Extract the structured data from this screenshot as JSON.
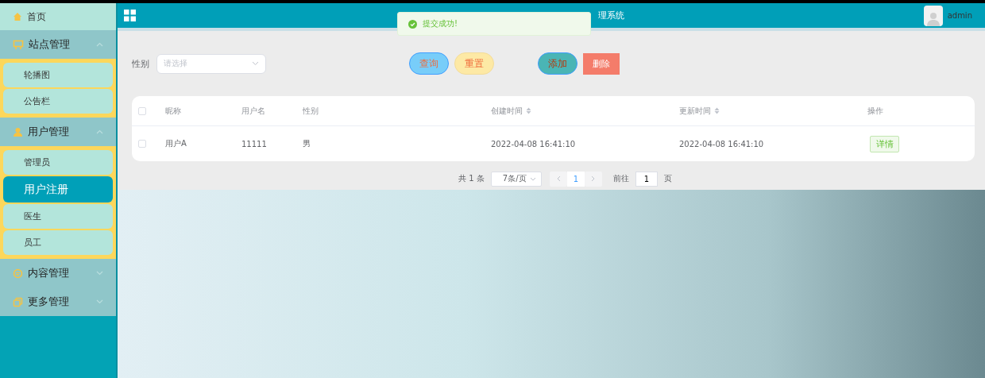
{
  "header": {
    "title": "理系统",
    "user": "admin"
  },
  "toast": {
    "message": "提交成功!"
  },
  "sidebar": {
    "items": [
      {
        "kind": "link",
        "label": "首页",
        "selected": false
      },
      {
        "kind": "group",
        "label": "站点管理",
        "expanded": true,
        "children": [
          {
            "label": "轮播图",
            "selected": false
          },
          {
            "label": "公告栏",
            "selected": false
          }
        ]
      },
      {
        "kind": "group",
        "label": "用户管理",
        "expanded": true,
        "children": [
          {
            "label": "管理员",
            "selected": false
          },
          {
            "label": "用户注册",
            "selected": true
          },
          {
            "label": "医生",
            "selected": false
          },
          {
            "label": "员工",
            "selected": false
          }
        ]
      },
      {
        "kind": "group",
        "label": "内容管理",
        "expanded": false
      },
      {
        "kind": "group",
        "label": "更多管理",
        "expanded": false
      }
    ]
  },
  "filters": [
    {
      "label": "性别",
      "placeholder": "请选择"
    }
  ],
  "buttons": [
    {
      "kind": "search",
      "label": "查询"
    },
    {
      "kind": "reset",
      "label": "重置"
    },
    {
      "kind": "add",
      "label": "添加"
    },
    {
      "kind": "delete",
      "label": "删除"
    }
  ],
  "table": {
    "select_all": false,
    "columns": [
      {
        "label": "昵称",
        "sortable": false
      },
      {
        "label": "用户名",
        "sortable": false
      },
      {
        "label": "性别",
        "sortable": false
      },
      {
        "label": "创建时间",
        "sortable": true
      },
      {
        "label": "更新时间",
        "sortable": true
      },
      {
        "label": "操作",
        "sortable": false
      }
    ],
    "rows": [
      {
        "checked": false,
        "cells": [
          "用户A",
          "11111",
          "男",
          "2022-04-08 16:41:10",
          "2022-04-08 16:41:10"
        ],
        "action": "详情"
      }
    ]
  },
  "pagination": {
    "total": "共 1 条",
    "page_size": "7条/页",
    "prev_disabled": true,
    "next_disabled": true,
    "pages": [
      {
        "label": "1",
        "selected": true
      }
    ],
    "goto_label": "前往",
    "goto_value": "1",
    "goto_suffix": "页"
  }
}
